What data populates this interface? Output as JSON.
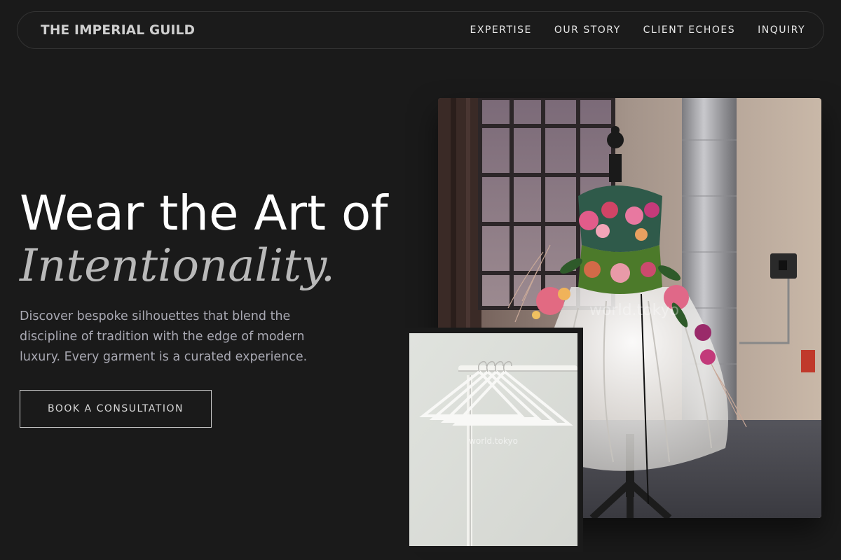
{
  "nav": {
    "brand": "THE IMPERIAL GUILD",
    "links": [
      {
        "label": "EXPERTISE"
      },
      {
        "label": "OUR STORY"
      },
      {
        "label": "CLIENT ECHOES"
      },
      {
        "label": "INQUIRY"
      }
    ]
  },
  "hero": {
    "title_line1": "Wear the Art of",
    "title_line2": "Intentionality.",
    "description": "Discover bespoke silhouettes that blend the discipline of tradition with the edge of modern luxury. Every garment is a curated experience.",
    "cta_label": "BOOK A CONSULTATION"
  },
  "images": {
    "main_watermark": "world.tokyo",
    "small_watermark": "world.tokyo"
  },
  "colors": {
    "background": "#1a1a1a",
    "nav_border": "#333333",
    "text_primary": "#ffffff",
    "text_accent": "#b9b9b9",
    "text_muted": "#a9a9b3"
  }
}
